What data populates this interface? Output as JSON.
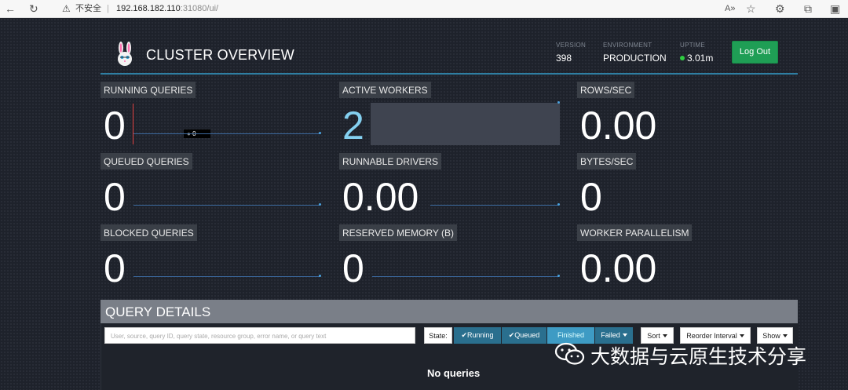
{
  "browser": {
    "back_icon": "←",
    "refresh_icon": "↻",
    "warning_icon": "⚠",
    "security_label": "不安全",
    "separator": "|",
    "url_host": "192.168.182.110",
    "url_rest": ":31080/ui/",
    "read_aloud_icon": "A»",
    "favorites_icon": "☆",
    "extensions_icon": "⚙",
    "split_icon": "⧉",
    "collections_icon": "▣"
  },
  "header": {
    "title": "CLUSTER OVERVIEW",
    "version_label": "VERSION",
    "version_value": "398",
    "environment_label": "ENVIRONMENT",
    "environment_value": "PRODUCTION",
    "uptime_label": "UPTIME",
    "uptime_value": "3.01m",
    "logout_label": "Log Out"
  },
  "tiles": [
    {
      "label": "RUNNING QUERIES",
      "value": "0",
      "tooltip": "0"
    },
    {
      "label": "ACTIVE WORKERS",
      "value": "2"
    },
    {
      "label": "ROWS/SEC",
      "value": "0.00"
    },
    {
      "label": "QUEUED QUERIES",
      "value": "0"
    },
    {
      "label": "RUNNABLE DRIVERS",
      "value": "0.00"
    },
    {
      "label": "BYTES/SEC",
      "value": "0"
    },
    {
      "label": "BLOCKED QUERIES",
      "value": "0"
    },
    {
      "label": "RESERVED MEMORY (B)",
      "value": "0"
    },
    {
      "label": "WORKER PARALLELISM",
      "value": "0.00"
    }
  ],
  "query_details": {
    "title": "QUERY DETAILS",
    "search_placeholder": "User, source, query ID, query state, resource group, error name, or query text",
    "state_label": "State:",
    "running_label": "Running",
    "queued_label": "Queued",
    "finished_label": "Finished",
    "failed_label": "Failed",
    "sort_label": "Sort",
    "reorder_label": "Reorder Interval",
    "show_label": "Show",
    "empty_message": "No queries"
  },
  "watermark": {
    "text": "大数据与云原生技术分享"
  },
  "colors": {
    "background": "#1e222b",
    "accent": "#2f7fa3",
    "logout": "#1f9e55",
    "active_value": "#84d0f0"
  }
}
